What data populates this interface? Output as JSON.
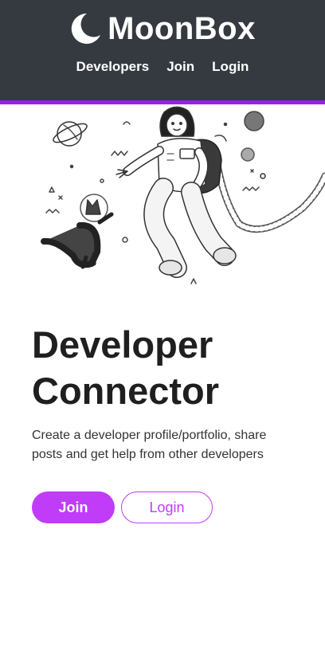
{
  "brand": {
    "name": "MoonBox",
    "logo_icon": "moon-icon"
  },
  "nav": {
    "links": [
      {
        "label": "Developers"
      },
      {
        "label": "Join"
      },
      {
        "label": "Login"
      }
    ]
  },
  "hero": {
    "illustration": "astronaut-and-cat-illustration",
    "title_line1": "Developer",
    "title_line2": "Connector",
    "lead_line1": "Create a developer profile/portfolio, share",
    "lead_line2": "posts and get help from other developers",
    "join_label": "Join",
    "login_label": "Login"
  },
  "colors": {
    "navbar": "#343a40",
    "accent": "#c03cf8",
    "accent_border": "#9b1cf0"
  }
}
